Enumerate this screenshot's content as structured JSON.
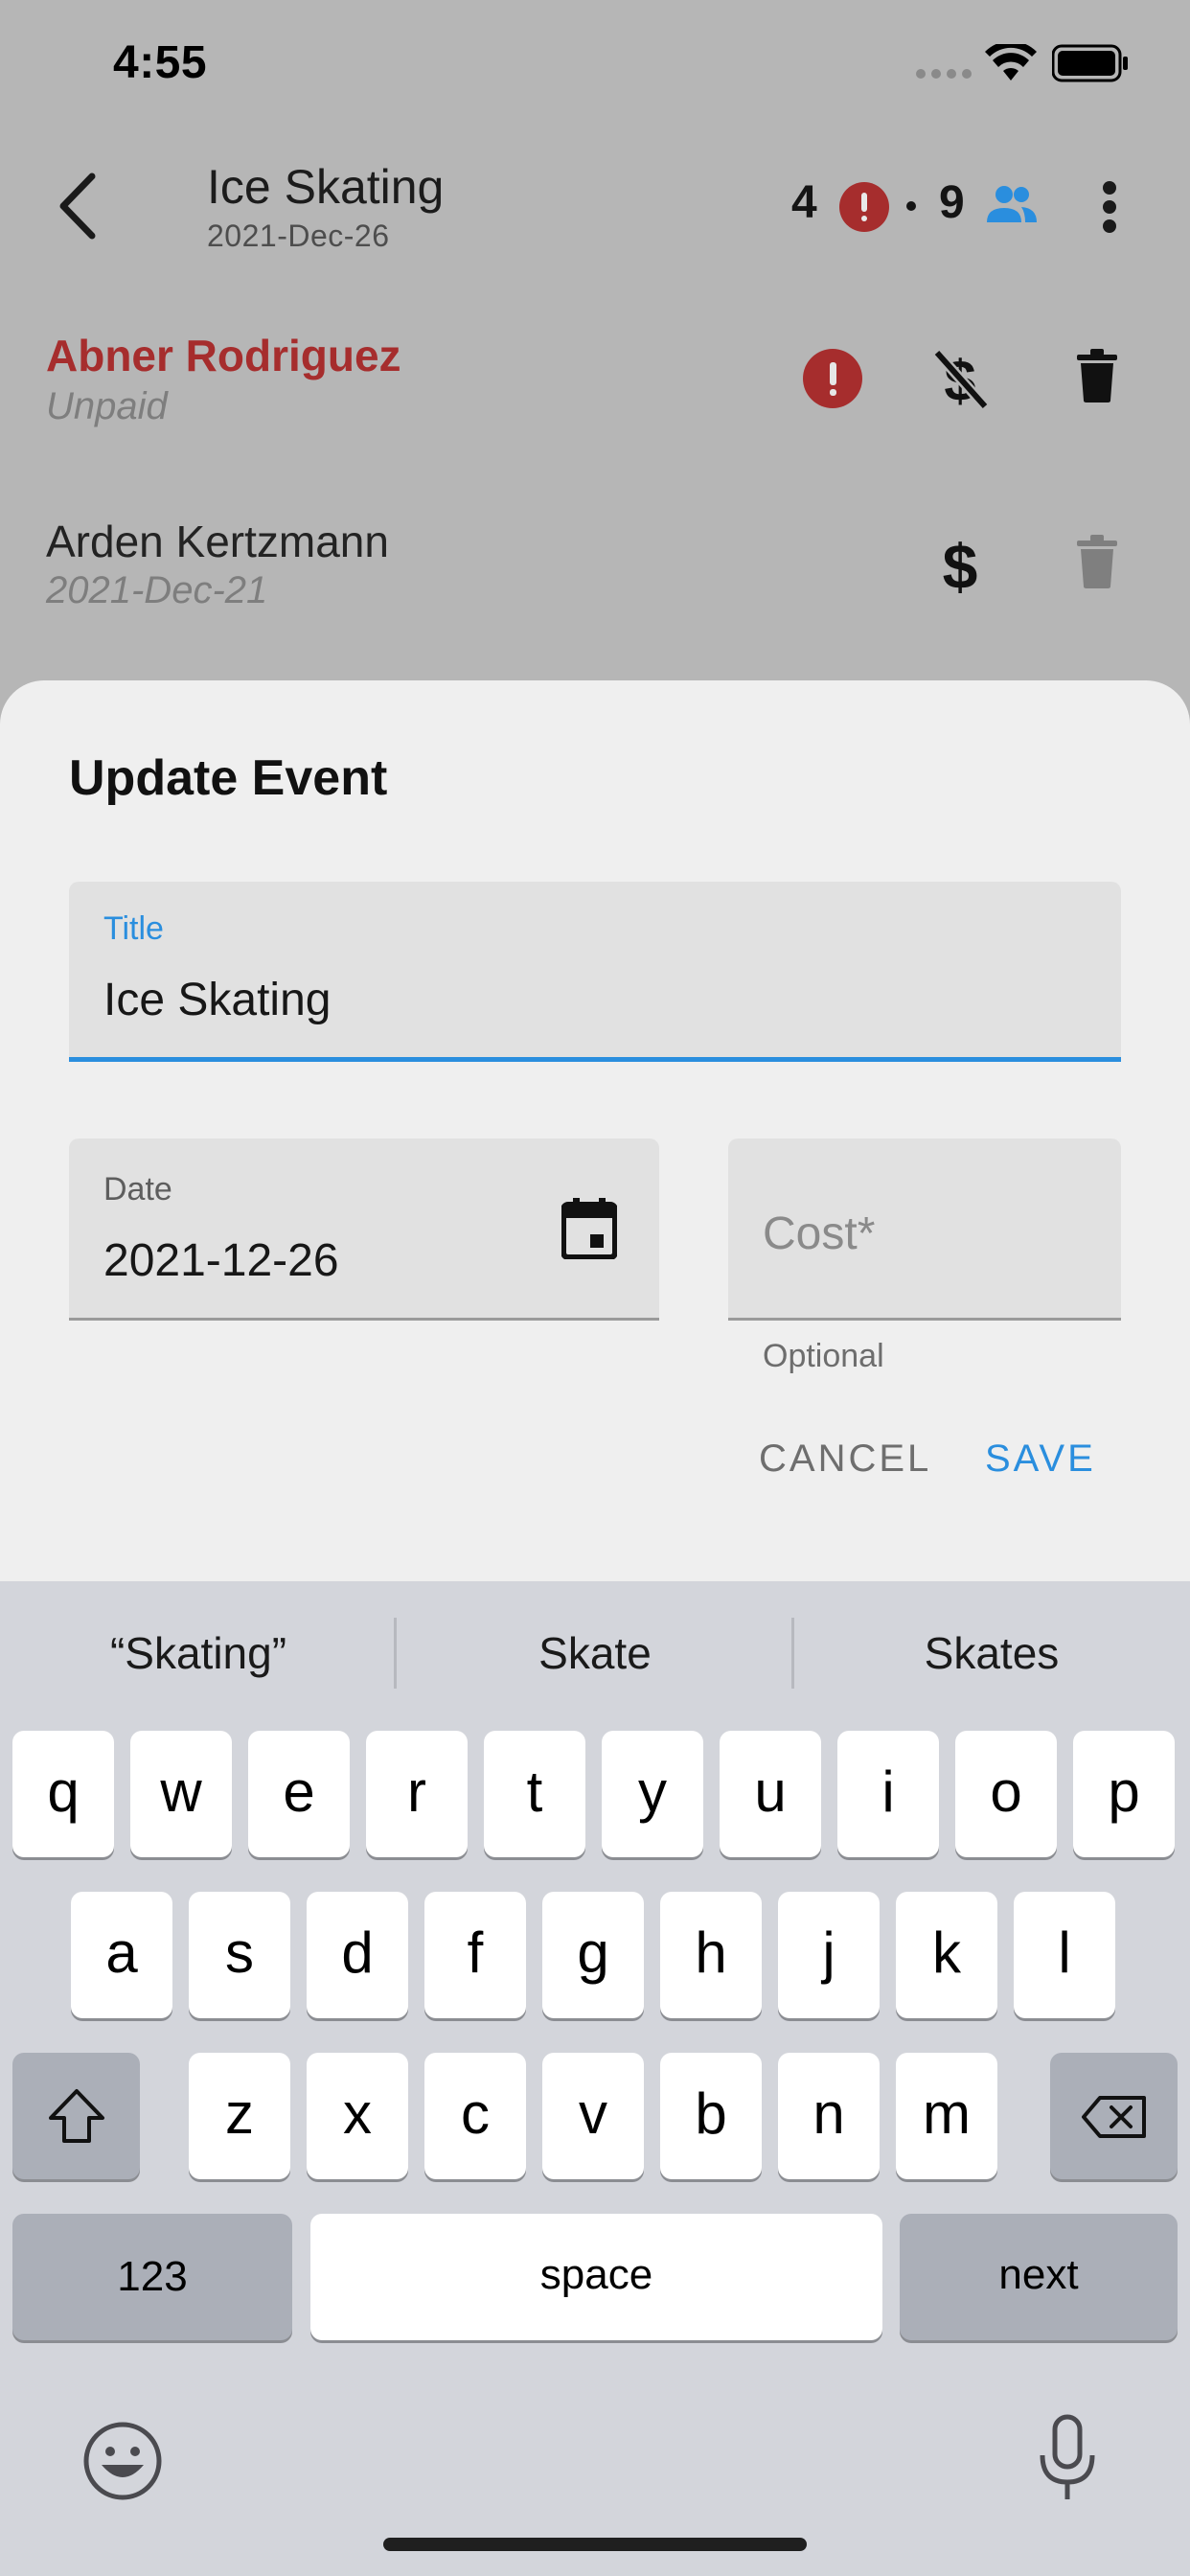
{
  "status_bar": {
    "time": "4:55"
  },
  "app_bar": {
    "title": "Ice Skating",
    "subtitle": "2021-Dec-26",
    "unpaid_count": "4",
    "people_count": "9"
  },
  "participants": [
    {
      "name": "Abner Rodriguez",
      "status": "Unpaid"
    },
    {
      "name": "Arden Kertzmann",
      "status": "2021-Dec-21"
    }
  ],
  "dialog": {
    "heading": "Update Event",
    "title_field": {
      "label": "Title",
      "value": "Ice Skating"
    },
    "date_field": {
      "label": "Date",
      "value": "2021-12-26"
    },
    "cost_field": {
      "placeholder": "Cost*",
      "helper": "Optional"
    },
    "cancel_label": "CANCEL",
    "save_label": "SAVE"
  },
  "keyboard": {
    "suggestions": [
      "“Skating”",
      "Skate",
      "Skates"
    ],
    "row1": [
      "q",
      "w",
      "e",
      "r",
      "t",
      "y",
      "u",
      "i",
      "o",
      "p"
    ],
    "row2": [
      "a",
      "s",
      "d",
      "f",
      "g",
      "h",
      "j",
      "k",
      "l"
    ],
    "row3": [
      "z",
      "x",
      "c",
      "v",
      "b",
      "n",
      "m"
    ],
    "numbers_label": "123",
    "space_label": "space",
    "return_label": "next"
  },
  "colors": {
    "accent": "#2a8ede",
    "alert": "#a62d2d",
    "scrim": "#b6b6b6",
    "sheet": "#efefef",
    "keyboard": "#d3d5db"
  }
}
